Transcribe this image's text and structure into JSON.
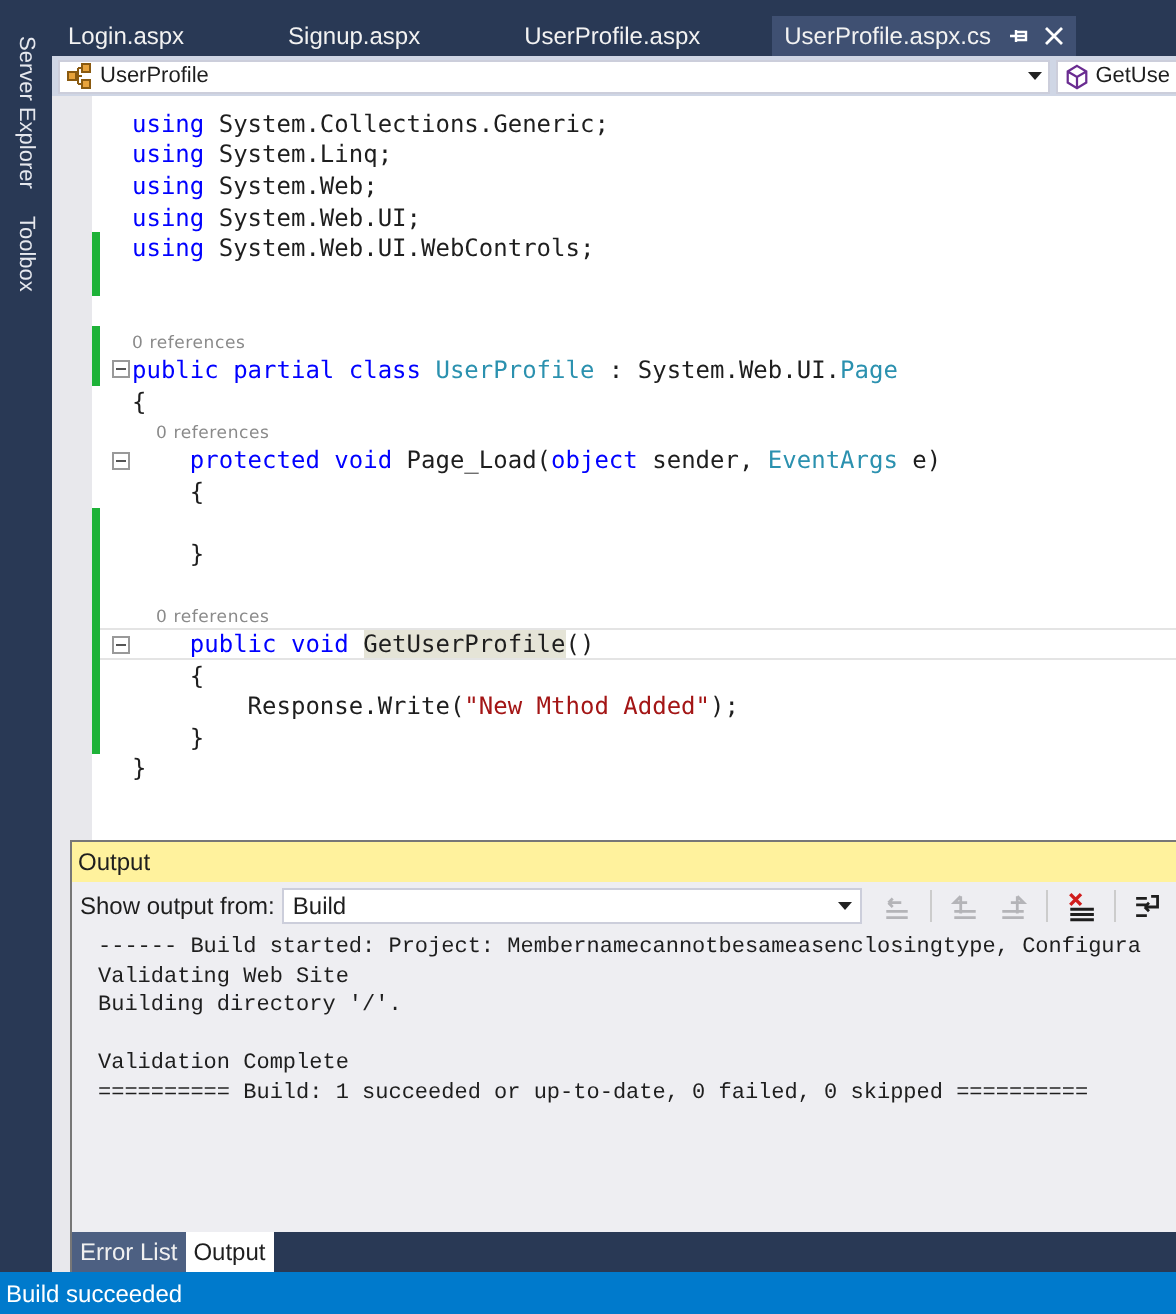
{
  "side_tabs": [
    "Server Explorer",
    "Toolbox"
  ],
  "tabs": [
    {
      "label": "Login.aspx",
      "selected": false
    },
    {
      "label": "Signup.aspx",
      "selected": false
    },
    {
      "label": "UserProfile.aspx",
      "selected": false
    },
    {
      "label": "UserProfile.aspx.cs",
      "selected": true
    }
  ],
  "navigation": {
    "type_dropdown": "UserProfile",
    "member_dropdown": "GetUse"
  },
  "code_lines": [
    {
      "kind": "code",
      "changed": false,
      "fold": false,
      "tokens": [
        {
          "kind": "keyword",
          "text": "using"
        },
        {
          "kind": "plain",
          "text": " System.Collections.Generic;"
        }
      ]
    },
    {
      "kind": "code",
      "changed": false,
      "fold": false,
      "tokens": [
        {
          "kind": "keyword",
          "text": "using"
        },
        {
          "kind": "plain",
          "text": " System.Linq;"
        }
      ]
    },
    {
      "kind": "code",
      "changed": false,
      "fold": false,
      "tokens": [
        {
          "kind": "keyword",
          "text": "using"
        },
        {
          "kind": "plain",
          "text": " System.Web;"
        }
      ]
    },
    {
      "kind": "code",
      "changed": false,
      "fold": false,
      "tokens": [
        {
          "kind": "keyword",
          "text": "using"
        },
        {
          "kind": "plain",
          "text": " System.Web.UI;"
        }
      ]
    },
    {
      "kind": "code",
      "changed": true,
      "fold": false,
      "tokens": [
        {
          "kind": "keyword",
          "text": "using"
        },
        {
          "kind": "plain",
          "text": " System.Web.UI.WebControls;"
        }
      ]
    },
    {
      "kind": "blank",
      "changed": true,
      "fold": false
    },
    {
      "kind": "blank",
      "changed": false,
      "fold": false
    },
    {
      "kind": "lens",
      "changed": true,
      "fold": false,
      "text": "0 references"
    },
    {
      "kind": "code",
      "changed": true,
      "fold": true,
      "tokens": [
        {
          "kind": "keyword",
          "text": "public partial class"
        },
        {
          "kind": "type",
          "text": " UserProfile"
        },
        {
          "kind": "plain",
          "text": " : System.Web.UI."
        },
        {
          "kind": "type",
          "text": "Page"
        }
      ]
    },
    {
      "kind": "code",
      "changed": false,
      "fold": false,
      "tokens": [
        {
          "kind": "plain",
          "text": "{"
        }
      ]
    },
    {
      "kind": "lens",
      "changed": false,
      "fold": false,
      "text": "    0 references"
    },
    {
      "kind": "code",
      "changed": false,
      "fold": true,
      "tokens": [
        {
          "kind": "keyword",
          "text": "    protected void"
        },
        {
          "kind": "plain",
          "text": " Page_Load("
        },
        {
          "kind": "keyword",
          "text": "object"
        },
        {
          "kind": "plain",
          "text": " sender, "
        },
        {
          "kind": "type",
          "text": "EventArgs"
        },
        {
          "kind": "plain",
          "text": " e)"
        }
      ]
    },
    {
      "kind": "code",
      "changed": false,
      "fold": false,
      "tokens": [
        {
          "kind": "plain",
          "text": "    {"
        }
      ]
    },
    {
      "kind": "blank",
      "changed": true,
      "fold": false
    },
    {
      "kind": "code",
      "changed": true,
      "fold": false,
      "tokens": [
        {
          "kind": "plain",
          "text": "    }"
        }
      ]
    },
    {
      "kind": "blank",
      "changed": true,
      "fold": false
    },
    {
      "kind": "lens",
      "changed": true,
      "fold": false,
      "text": "    0 references"
    },
    {
      "kind": "code",
      "changed": true,
      "fold": true,
      "current": true,
      "tokens": [
        {
          "kind": "keyword",
          "text": "    public void "
        },
        {
          "kind": "highlight",
          "text": "GetUserProfile"
        },
        {
          "kind": "plain",
          "text": "()"
        }
      ]
    },
    {
      "kind": "code",
      "changed": true,
      "fold": false,
      "tokens": [
        {
          "kind": "plain",
          "text": "    {"
        }
      ]
    },
    {
      "kind": "code",
      "changed": true,
      "fold": false,
      "tokens": [
        {
          "kind": "plain",
          "text": "        Response.Write("
        },
        {
          "kind": "string",
          "text": "\"New Mthod Added\""
        },
        {
          "kind": "plain",
          "text": ");"
        }
      ]
    },
    {
      "kind": "code",
      "changed": true,
      "fold": false,
      "tokens": [
        {
          "kind": "plain",
          "text": "    }"
        }
      ]
    },
    {
      "kind": "code",
      "changed": false,
      "fold": false,
      "tokens": [
        {
          "kind": "plain",
          "text": "}"
        }
      ]
    }
  ],
  "output": {
    "title": "Output",
    "source_label": "Show output from:",
    "source": "Build",
    "toolbar": [
      {
        "kind": "goto",
        "disabled": true
      },
      {
        "kind": "previous",
        "disabled": true
      },
      {
        "kind": "next",
        "disabled": true
      },
      {
        "kind": "clear",
        "disabled": false
      },
      {
        "kind": "wrap",
        "disabled": false
      }
    ],
    "paragraphs": [
      [
        "------ Build started: Project: Membernamecannotbesameasenclosingtype, Configura",
        "Validating Web Site",
        "Building directory '/'."
      ],
      [
        "Validation Complete",
        "========== Build: 1 succeeded or up-to-date, 0 failed, 0 skipped =========="
      ]
    ]
  },
  "bottom_tabs": [
    {
      "label": "Error List",
      "selected": false
    },
    {
      "label": "Output",
      "selected": true
    }
  ],
  "status_bar": {
    "text": "Build succeeded"
  }
}
